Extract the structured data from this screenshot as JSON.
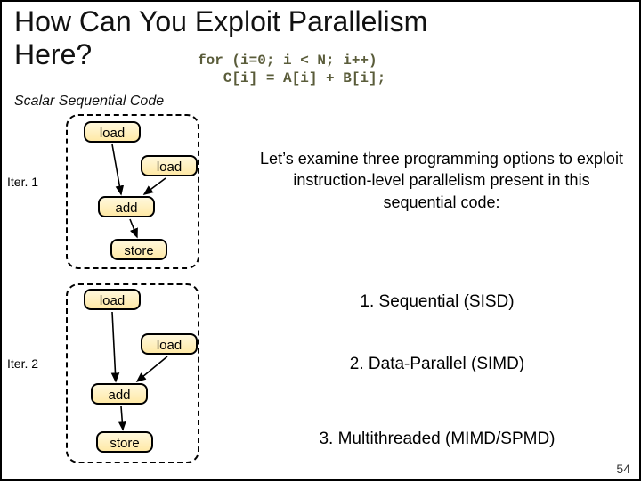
{
  "title": {
    "line1": "How Can You Exploit Parallelism",
    "line2": "Here?"
  },
  "code": {
    "line1": "for (i=0; i < N; i++)",
    "line2": "   C[i] = A[i] + B[i];"
  },
  "subtitle": "Scalar Sequential Code",
  "iterations": {
    "iter1_label": "Iter. 1",
    "iter2_label": "Iter. 2"
  },
  "ops": {
    "load": "load",
    "add": "add",
    "store": "store"
  },
  "body_text": "Let’s examine three programming options to exploit instruction-level parallelism present in this sequential code:",
  "options": {
    "opt1": "1. Sequential (SISD)",
    "opt2": "2. Data-Parallel (SIMD)",
    "opt3": "3. Multithreaded (MIMD/SPMD)"
  },
  "slide_number": "54",
  "chart_data": {
    "type": "diagram",
    "iterations": [
      {
        "name": "Iter. 1",
        "nodes": [
          "load",
          "load",
          "add",
          "store"
        ],
        "edges": [
          [
            "load_1",
            "add"
          ],
          [
            "load_2",
            "add"
          ],
          [
            "add",
            "store"
          ]
        ]
      },
      {
        "name": "Iter. 2",
        "nodes": [
          "load",
          "load",
          "add",
          "store"
        ],
        "edges": [
          [
            "load_1",
            "add"
          ],
          [
            "load_2",
            "add"
          ],
          [
            "add",
            "store"
          ]
        ]
      }
    ],
    "options": [
      "1. Sequential (SISD)",
      "2. Data-Parallel (SIMD)",
      "3. Multithreaded (MIMD/SPMD)"
    ],
    "code": "for (i=0; i < N; i++) C[i] = A[i] + B[i];"
  }
}
